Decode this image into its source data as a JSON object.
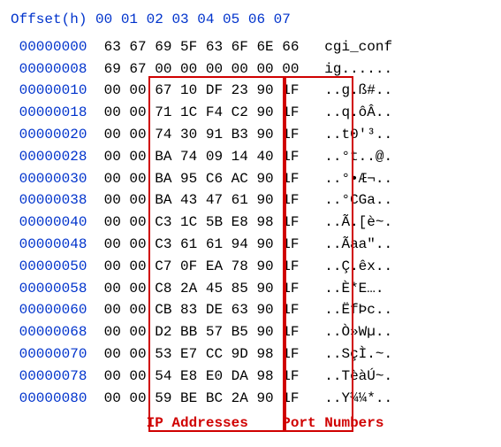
{
  "header": {
    "title": "Offset(h)",
    "cols": [
      "00",
      "01",
      "02",
      "03",
      "04",
      "05",
      "06",
      "07"
    ]
  },
  "rows": [
    {
      "offset": "00000000",
      "bytes": [
        "63",
        "67",
        "69",
        "5F",
        "63",
        "6F",
        "6E",
        "66"
      ],
      "ascii": "cgi_conf"
    },
    {
      "offset": "00000008",
      "bytes": [
        "69",
        "67",
        "00",
        "00",
        "00",
        "00",
        "00",
        "00"
      ],
      "ascii": "ig......"
    },
    {
      "offset": "00000010",
      "bytes": [
        "00",
        "00",
        "67",
        "10",
        "DF",
        "23",
        "90",
        "1F"
      ],
      "ascii": "..g.ß#.."
    },
    {
      "offset": "00000018",
      "bytes": [
        "00",
        "00",
        "71",
        "1C",
        "F4",
        "C2",
        "90",
        "1F"
      ],
      "ascii": "..q.ôÂ.."
    },
    {
      "offset": "00000020",
      "bytes": [
        "00",
        "00",
        "74",
        "30",
        "91",
        "B3",
        "90",
        "1F"
      ],
      "ascii": "..t0'³.."
    },
    {
      "offset": "00000028",
      "bytes": [
        "00",
        "00",
        "BA",
        "74",
        "09",
        "14",
        "40",
        "1F"
      ],
      "ascii": "..°t..@."
    },
    {
      "offset": "00000030",
      "bytes": [
        "00",
        "00",
        "BA",
        "95",
        "C6",
        "AC",
        "90",
        "1F"
      ],
      "ascii": "..°•Æ¬.."
    },
    {
      "offset": "00000038",
      "bytes": [
        "00",
        "00",
        "BA",
        "43",
        "47",
        "61",
        "90",
        "1F"
      ],
      "ascii": "..°CGa.."
    },
    {
      "offset": "00000040",
      "bytes": [
        "00",
        "00",
        "C3",
        "1C",
        "5B",
        "E8",
        "98",
        "1F"
      ],
      "ascii": "..Ã.[è~."
    },
    {
      "offset": "00000048",
      "bytes": [
        "00",
        "00",
        "C3",
        "61",
        "61",
        "94",
        "90",
        "1F"
      ],
      "ascii": "..Ãaa\".."
    },
    {
      "offset": "00000050",
      "bytes": [
        "00",
        "00",
        "C7",
        "0F",
        "EA",
        "78",
        "90",
        "1F"
      ],
      "ascii": "..Ç.êx.."
    },
    {
      "offset": "00000058",
      "bytes": [
        "00",
        "00",
        "C8",
        "2A",
        "45",
        "85",
        "90",
        "1F"
      ],
      "ascii": "..È*E…."
    },
    {
      "offset": "00000060",
      "bytes": [
        "00",
        "00",
        "CB",
        "83",
        "DE",
        "63",
        "90",
        "1F"
      ],
      "ascii": "..ËfÞc.."
    },
    {
      "offset": "00000068",
      "bytes": [
        "00",
        "00",
        "D2",
        "BB",
        "57",
        "B5",
        "90",
        "1F"
      ],
      "ascii": "..Ò»Wµ.."
    },
    {
      "offset": "00000070",
      "bytes": [
        "00",
        "00",
        "53",
        "E7",
        "CC",
        "9D",
        "98",
        "1F"
      ],
      "ascii": "..SçÌ.~."
    },
    {
      "offset": "00000078",
      "bytes": [
        "00",
        "00",
        "54",
        "E8",
        "E0",
        "DA",
        "98",
        "1F"
      ],
      "ascii": "..TèàÚ~."
    },
    {
      "offset": "00000080",
      "bytes": [
        "00",
        "00",
        "59",
        "BE",
        "BC",
        "2A",
        "90",
        "1F"
      ],
      "ascii": "..Y¾¼*.."
    }
  ],
  "annotations": {
    "ip_label": "IP Addresses",
    "port_label": "Port Numbers"
  }
}
